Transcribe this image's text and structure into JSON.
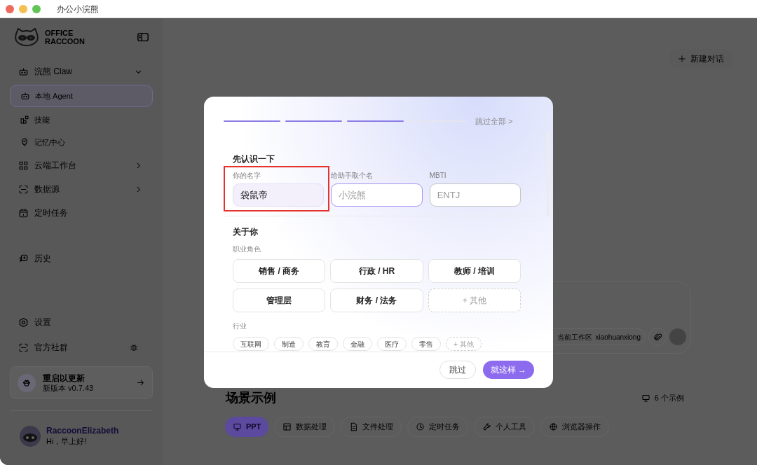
{
  "window": {
    "title": "办公小浣熊"
  },
  "sidebar": {
    "logo": [
      "OFFICE",
      "RACCOON"
    ],
    "nav": [
      {
        "label": "浣熊 Claw",
        "selected": false,
        "expanded": true,
        "children": [
          {
            "label": "本地 Agent",
            "selected": true
          },
          {
            "label": "技能",
            "selected": false
          },
          {
            "label": "记忆中心",
            "selected": false
          }
        ]
      },
      {
        "label": "云端工作台",
        "selected": false,
        "expanded": false
      },
      {
        "label": "数据源",
        "selected": false,
        "expanded": false
      },
      {
        "label": "定时任务",
        "selected": false
      },
      {
        "label": "历史",
        "selected": false
      }
    ],
    "footer_items": [
      {
        "label": "设置"
      },
      {
        "label": "官方社群"
      }
    ],
    "update_card": {
      "title": "重启以更新",
      "version": "新版本 v0.7.43"
    },
    "user": {
      "name": "RaccoonElizabeth",
      "greeting": "Hi，早上好!"
    }
  },
  "main": {
    "new_chat_button": "新建对话",
    "composer": {
      "workspace_label": "当前工作区",
      "workspace": "xiaohuanxiong"
    },
    "scenarios": {
      "title": "场景示例",
      "count": "6 个示例",
      "tabs": [
        {
          "label": "PPT",
          "selected": true
        },
        {
          "label": "数据处理",
          "selected": false
        },
        {
          "label": "文件处理",
          "selected": false
        },
        {
          "label": "定时任务",
          "selected": false
        },
        {
          "label": "个人工具",
          "selected": false
        },
        {
          "label": "浏览器操作",
          "selected": false
        }
      ]
    }
  },
  "dialog": {
    "progress": [
      {
        "done": true
      },
      {
        "done": true
      },
      {
        "done": true
      },
      {
        "done": false
      }
    ],
    "skip_all": "跳过全部 >",
    "intro": {
      "title": "先认识一下",
      "fields": [
        {
          "label": "你的名字",
          "value": "袋鼠帝",
          "focused": false,
          "highlighted": true
        },
        {
          "label": "给助手取个名",
          "placeholder": "小浣熊",
          "focused": true,
          "highlighted": false
        },
        {
          "label": "MBTI",
          "placeholder": "ENTJ",
          "focused": false,
          "highlighted": false
        }
      ]
    },
    "about": {
      "title": "关于你",
      "role_label": "职业角色",
      "roles": [
        {
          "label": "销售 / 商务",
          "kind": "option",
          "selected": false
        },
        {
          "label": "行政 / HR",
          "kind": "option",
          "selected": false
        },
        {
          "label": "教师 / 培训",
          "kind": "option",
          "selected": false
        },
        {
          "label": "管理层",
          "kind": "option",
          "selected": false
        },
        {
          "label": "财务 / 法务",
          "kind": "option",
          "selected": false
        },
        {
          "label": "+ 其他",
          "kind": "add",
          "selected": false
        }
      ],
      "industry_label": "行业",
      "industries": [
        {
          "label": "互联网",
          "kind": "option",
          "selected": false
        },
        {
          "label": "制造",
          "kind": "option",
          "selected": false
        },
        {
          "label": "教育",
          "kind": "option",
          "selected": false
        },
        {
          "label": "金融",
          "kind": "option",
          "selected": false
        },
        {
          "label": "医疗",
          "kind": "option",
          "selected": false
        },
        {
          "label": "零售",
          "kind": "option",
          "selected": false
        },
        {
          "label": "+ 其他",
          "kind": "add",
          "selected": false
        }
      ]
    },
    "buttons": {
      "skip": "跳过",
      "confirm": "就这样 →"
    }
  }
}
